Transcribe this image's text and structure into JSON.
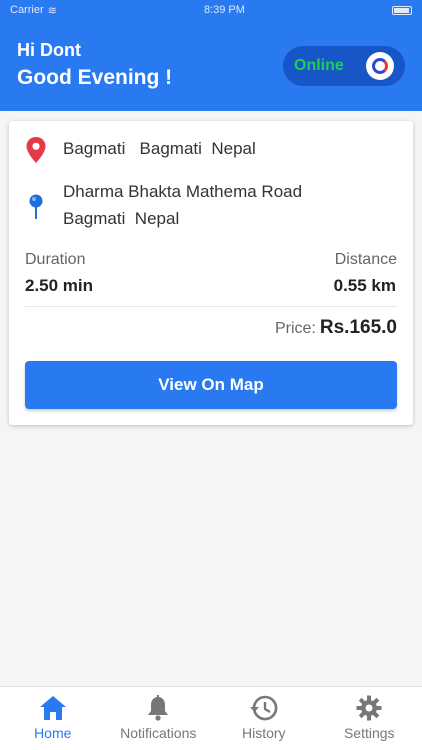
{
  "status_bar": {
    "carrier": "Carrier",
    "time": "8:39 PM"
  },
  "header": {
    "greeting_name": "Hi Dont",
    "greeting_time": "Good Evening !",
    "status_label": "Online"
  },
  "ride": {
    "pickup": "Bagmati   Bagmati  Nepal",
    "dropoff": "Dharma Bhakta Mathema Road\nBagmati  Nepal",
    "duration_label": "Duration",
    "duration_value": "2.50 min",
    "distance_label": "Distance",
    "distance_value": "0.55 km",
    "price_label": "Price:",
    "price_value": "Rs.165.0",
    "map_button": "View On Map"
  },
  "nav": {
    "items": [
      {
        "label": "Home",
        "icon": "home-icon",
        "active": true
      },
      {
        "label": "Notifications",
        "icon": "bell-icon",
        "active": false
      },
      {
        "label": "History",
        "icon": "history-icon",
        "active": false
      },
      {
        "label": "Settings",
        "icon": "gear-icon",
        "active": false
      }
    ]
  },
  "colors": {
    "primary": "#2979f0",
    "toggle_bg": "#1656c7",
    "online": "#1fd14a",
    "pickup_pin": "#e53945",
    "dropoff_pin": "#1e6fd9"
  }
}
